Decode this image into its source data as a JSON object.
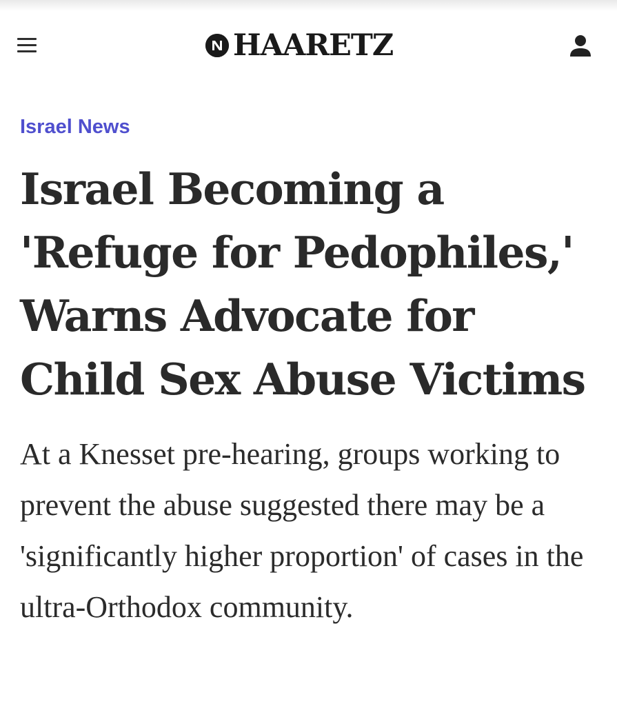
{
  "header": {
    "logo_text": "HAARETZ",
    "menu_icon": "hamburger-menu-icon",
    "account_icon": "user-account-icon"
  },
  "article": {
    "section": "Israel News",
    "headline": "Israel Becoming a 'Refuge for Pedophiles,' Warns Advocate for Child Sex Abuse Victims",
    "dek": "At a Knesset pre-hearing, groups working to prevent the abuse suggested there may be a 'significantly higher proportion' of cases in the ultra-Orthodox community."
  },
  "colors": {
    "section_label": "#4f4fce",
    "text": "#2b2b2b",
    "logo": "#1a1a1a",
    "background": "#ffffff"
  }
}
